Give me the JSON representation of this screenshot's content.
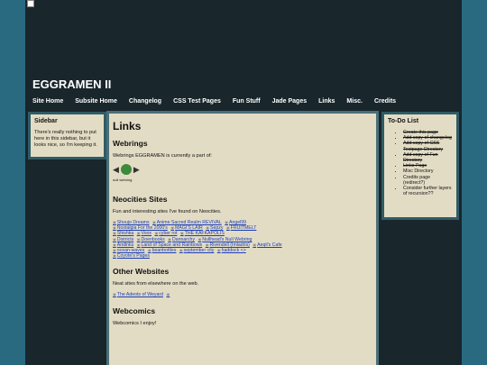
{
  "site": {
    "title": "EGGRAMEN II"
  },
  "nav": [
    "Site Home",
    "Subsite Home",
    "Changelog",
    "CSS Test Pages",
    "Fun Stuff",
    "Jade Pages",
    "Links",
    "Misc.",
    "Credits"
  ],
  "left_sidebar": {
    "heading": "Sidebar",
    "text": "There's really nothing to put here in this sidebar, but it looks nice, so I'm keeping it."
  },
  "main": {
    "title": "Links",
    "webrings": {
      "heading": "Webrings",
      "text": "Webrings EGGRAMEN is currently a part of:",
      "ring_label": "null webring"
    },
    "neocities": {
      "heading": "Neocities Sites",
      "text": "Fun and interesting sites I've found on Neocities.",
      "links": [
        "Shoujo Dreams",
        "Anime Sacred Realm REVIVAL",
        "Angel99",
        "Nostalgia For the 2000's",
        "MAGI'S LAIR",
        "Sepzy",
        "FRUITMELT",
        "Shishka",
        "Voox",
        "cyber rot",
        "THE KAFKAPOLIS",
        "Districts",
        "Doenbooks",
        "Dannarchy",
        "Nullhead's Null Webring",
        "Andinks",
        "Land of Space and Rainbows",
        "Rivendell (Imladris)",
        "Aeqil's Cafe",
        "ocean-waves",
        "beanbottles",
        "september city",
        "haddock <>",
        "Coyote's Pages"
      ]
    },
    "other": {
      "heading": "Other Websites",
      "text": "Neat sites from elsewhere on the web.",
      "links": [
        "The Adeots of Weyard"
      ]
    },
    "webcomics": {
      "heading": "Webcomics",
      "text": "Webcomics I enjoy!"
    }
  },
  "todo": {
    "heading": "To-Do List",
    "items": [
      {
        "text": "Create this page",
        "done": true
      },
      {
        "text": "Add copy of changelog",
        "done": true
      },
      {
        "text": "Add copy of CSS Testpage Directory",
        "done": true
      },
      {
        "text": "Add copy of Fun Directory",
        "done": true
      },
      {
        "text": "Links Page",
        "done": true
      },
      {
        "text": "Misc Directory",
        "done": false
      },
      {
        "text": "Credits page (redirect?)",
        "done": false
      },
      {
        "text": "Consider further layers of recursion??",
        "done": false
      }
    ]
  }
}
